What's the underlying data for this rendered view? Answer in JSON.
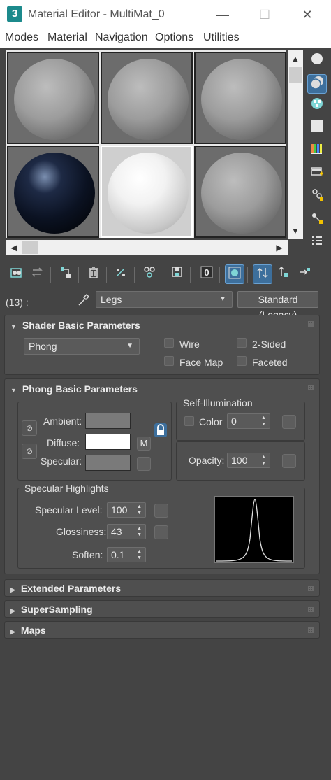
{
  "window": {
    "app_icon": "3",
    "title": "Material Editor - MultiMat_0",
    "minimize": "—",
    "maximize": "☐",
    "close": "✕"
  },
  "menu": [
    "Modes",
    "Material",
    "Navigation",
    "Options",
    "Utilities"
  ],
  "name_row": {
    "count": "(13) :",
    "material_name": "Legs",
    "material_type": "Standard (Legacy)"
  },
  "shader_basic": {
    "title": "Shader Basic Parameters",
    "shader": "Phong",
    "wire": "Wire",
    "two_sided": "2-Sided",
    "face_map": "Face Map",
    "faceted": "Faceted"
  },
  "phong_basic": {
    "title": "Phong Basic Parameters",
    "ambient": "Ambient:",
    "diffuse": "Diffuse:",
    "specular": "Specular:",
    "diffuse_map": "M",
    "self_illum_title": "Self-Illumination",
    "color_label": "Color",
    "color_value": "0",
    "opacity_label": "Opacity:",
    "opacity_value": "100",
    "ambient_color": "#7a7a7a",
    "diffuse_color": "#ffffff",
    "specular_color": "#7a7a7a"
  },
  "specular_highlights": {
    "title": "Specular Highlights",
    "level_label": "Specular Level:",
    "level_value": "100",
    "gloss_label": "Glossiness:",
    "gloss_value": "43",
    "soften_label": "Soften:",
    "soften_value": "0.1"
  },
  "rollouts": {
    "extended": "Extended Parameters",
    "supersampling": "SuperSampling",
    "maps": "Maps"
  }
}
